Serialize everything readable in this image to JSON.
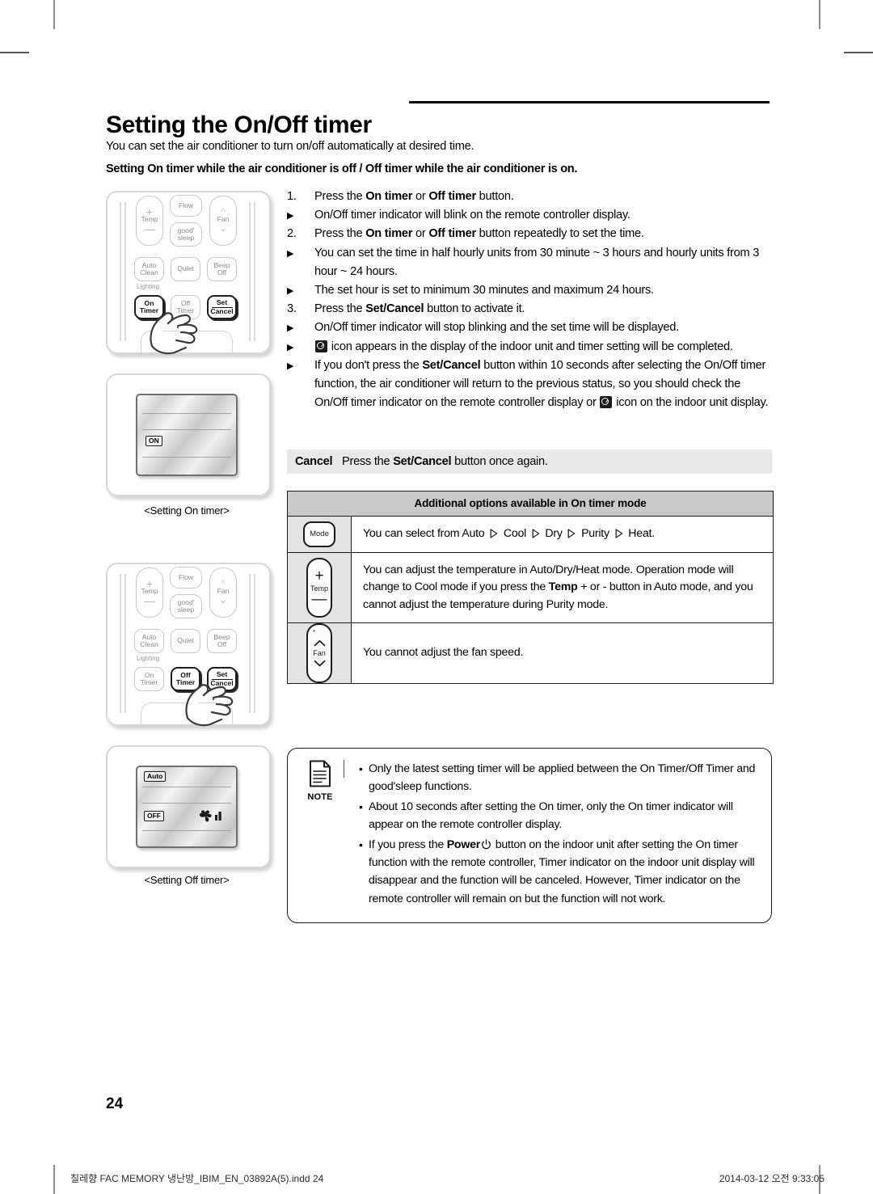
{
  "page": {
    "title": "Setting the On/Off timer",
    "intro": "You can set the air conditioner to turn on/off automatically at desired time.",
    "subheading": "Setting On timer while the air conditioner is off / Off timer while the air conditioner is on.",
    "page_number": "24"
  },
  "steps": [
    {
      "marker": "1.",
      "type": "number",
      "parts": [
        {
          "t": "Press the ",
          "b": false
        },
        {
          "t": "On timer",
          "b": true
        },
        {
          "t": " or ",
          "b": false
        },
        {
          "t": "Off timer",
          "b": true
        },
        {
          "t": " button.",
          "b": false
        }
      ]
    },
    {
      "marker": "▶",
      "type": "bullet",
      "parts": [
        {
          "t": "On/Off timer indicator will blink on the remote controller display.",
          "b": false
        }
      ]
    },
    {
      "marker": "2.",
      "type": "number",
      "parts": [
        {
          "t": "Press the ",
          "b": false
        },
        {
          "t": "On timer",
          "b": true
        },
        {
          "t": " or ",
          "b": false
        },
        {
          "t": "Off timer",
          "b": true
        },
        {
          "t": " button repeatedly to set the time.",
          "b": false
        }
      ]
    },
    {
      "marker": "▶",
      "type": "bullet",
      "parts": [
        {
          "t": "You can set the time in half hourly units from 30 minute ~ 3 hours and hourly units from 3 hour ~ 24 hours.",
          "b": false
        }
      ]
    },
    {
      "marker": "▶",
      "type": "bullet",
      "parts": [
        {
          "t": "The set hour is set to minimum 30 minutes and maximum 24 hours.",
          "b": false
        }
      ]
    },
    {
      "marker": "3.",
      "type": "number",
      "parts": [
        {
          "t": "Press the ",
          "b": false
        },
        {
          "t": "Set/Cancel",
          "b": true
        },
        {
          "t": " button to activate it.",
          "b": false
        }
      ]
    },
    {
      "marker": "▶",
      "type": "bullet",
      "parts": [
        {
          "t": "On/Off timer indicator will stop blinking and the set time will be displayed.",
          "b": false
        }
      ]
    },
    {
      "marker": "▶",
      "type": "bullet",
      "icon_lead": "clock-icon",
      "parts": [
        {
          "t": " icon appears in the display of the indoor unit and timer setting will  be completed.",
          "b": false
        }
      ]
    },
    {
      "marker": "▶",
      "type": "bullet",
      "parts": [
        {
          "t": "If you don't press the ",
          "b": false
        },
        {
          "t": "Set/Cancel",
          "b": true
        },
        {
          "t": " button within 10 seconds after selecting the On/Off timer function, the air conditioner will return to the previous status, so you should check the On/Off timer indicator on the remote controller display or ",
          "b": false
        },
        {
          "t": "",
          "b": false,
          "icon": "clock-icon"
        },
        {
          "t": " icon on the indoor unit display.",
          "b": false
        }
      ]
    }
  ],
  "cancel_band": {
    "label": "Cancel",
    "parts": [
      {
        "t": "Press the ",
        "b": false
      },
      {
        "t": "Set/Cancel",
        "b": true
      },
      {
        "t": " button once again.",
        "b": false
      }
    ]
  },
  "options_table": {
    "header": "Additional options available in On timer mode",
    "rows": [
      {
        "icon": "mode-button-icon",
        "icon_label": "Mode",
        "text_parts": [
          {
            "t": "You can select from Auto ",
            "b": false
          },
          {
            "t": "▷",
            "b": false,
            "arrow": true
          },
          {
            "t": " Cool ",
            "b": false
          },
          {
            "t": "▷",
            "b": false,
            "arrow": true
          },
          {
            "t": " Dry ",
            "b": false
          },
          {
            "t": "▷",
            "b": false,
            "arrow": true
          },
          {
            "t": " Purity ",
            "b": false
          },
          {
            "t": "▷",
            "b": false,
            "arrow": true
          },
          {
            "t": " Heat.",
            "b": false
          }
        ]
      },
      {
        "icon": "temp-button-icon",
        "icon_label": "Temp",
        "text_parts": [
          {
            "t": "You can adjust the temperature in Auto/Dry/Heat mode. Operation mode will change to Cool mode if you press the ",
            "b": false
          },
          {
            "t": "Temp",
            "b": true
          },
          {
            "t": " + or - button in Auto mode, and you cannot adjust the temperature during Purity mode.",
            "b": false
          }
        ]
      },
      {
        "icon": "fan-button-icon",
        "icon_label": "Fan",
        "text_parts": [
          {
            "t": "You cannot adjust the fan speed.",
            "b": false
          }
        ]
      }
    ]
  },
  "note": {
    "label": "NOTE",
    "items": [
      {
        "parts": [
          {
            "t": "Only the latest setting timer will be applied between the On Timer/Off Timer and good'sleep functions.",
            "b": false
          }
        ]
      },
      {
        "parts": [
          {
            "t": "About 10 seconds after setting the On timer, only the On timer indicator will appear on the remote controller display.",
            "b": false
          }
        ]
      },
      {
        "parts": [
          {
            "t": "If you press the ",
            "b": false
          },
          {
            "t": "Power",
            "b": true
          },
          {
            "t": "",
            "b": false,
            "icon": "power-icon"
          },
          {
            "t": " button on the indoor unit after setting the On timer function with the remote controller, Timer indicator on the indoor unit display will disappear and the function will be canceled. However, Timer indicator on the remote controller will remain on but the function will not work.",
            "b": false
          }
        ]
      }
    ]
  },
  "illustrations": {
    "remote_on": {
      "buttons": {
        "temp": "Temp",
        "flow": "Flow",
        "fan": "Fan",
        "goodsleep_a": "good'",
        "goodsleep_b": "sleep",
        "auto_clean_a": "Auto",
        "auto_clean_b": "Clean",
        "quiet": "Quiet",
        "beep_a": "Beep",
        "beep_b": "Off",
        "lighting": "Lighting",
        "on_timer_a": "On",
        "on_timer_b": "Timer",
        "off_timer_a": "Off",
        "off_timer_b": "Timer",
        "set_a": "Set",
        "cancel_b": "Cancel"
      }
    },
    "display_on": {
      "tag": "ON",
      "caption": "<Setting On timer>"
    },
    "remote_off": {
      "buttons": {
        "temp": "Temp",
        "flow": "Flow",
        "fan": "Fan",
        "goodsleep_a": "good'",
        "goodsleep_b": "sleep",
        "auto_clean_a": "Auto",
        "auto_clean_b": "Clean",
        "quiet": "Quiet",
        "beep_a": "Beep",
        "beep_b": "Off",
        "lighting": "Lighting",
        "on_timer_a": "On",
        "on_timer_b": "Timer",
        "off_timer_a": "Off",
        "off_timer_b": "Timer",
        "set_a": "Set",
        "cancel_b": "Cancel"
      }
    },
    "display_off": {
      "tag_mode": "Auto",
      "tag": "OFF",
      "caption": "<Setting Off timer>"
    }
  },
  "footer": {
    "left": "칠레향 FAC MEMORY 냉난방_IBIM_EN_03892A(5).indd   24",
    "right": "2014-03-12   오전 9:33:05"
  },
  "colors": {
    "band": "#e8e8e8",
    "table_header": "#c9c9c9",
    "icon_cell": "#e3e3e3",
    "ink": "#000000"
  }
}
